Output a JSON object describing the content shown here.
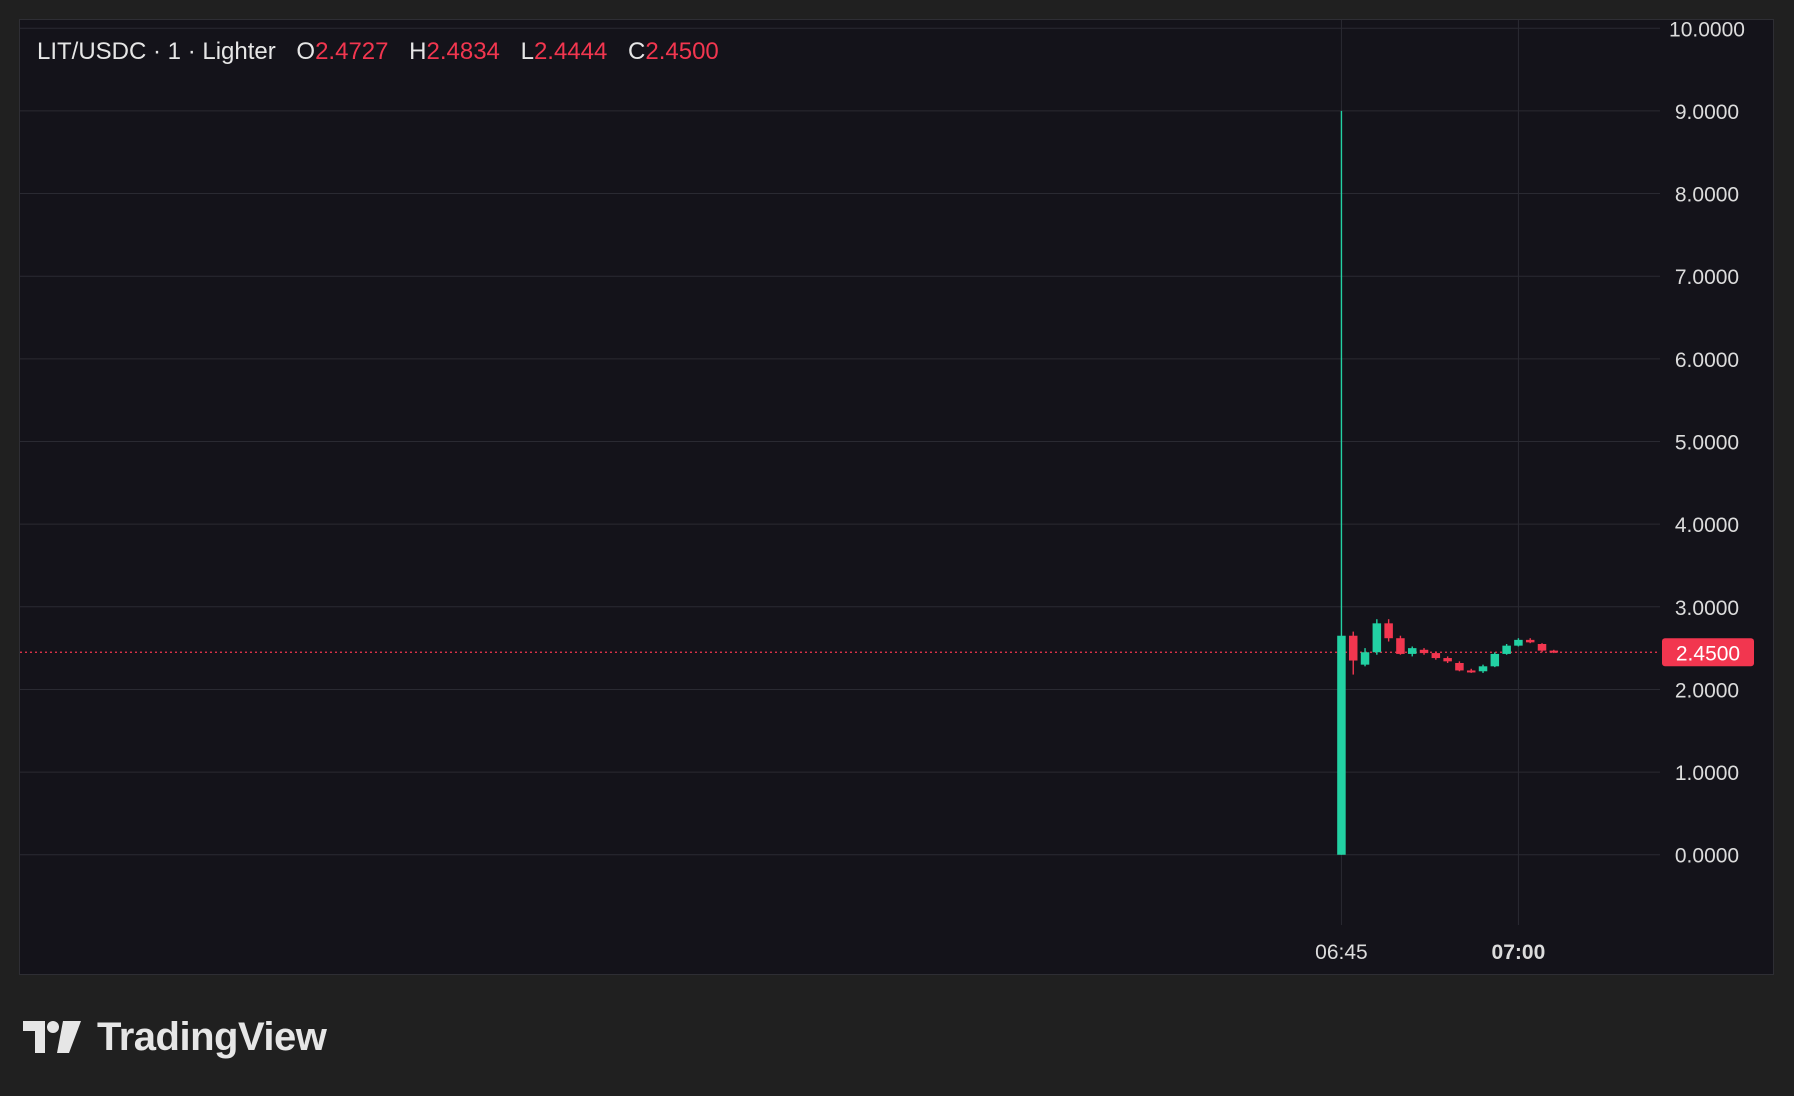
{
  "legend": {
    "symbol_text": "LIT/USDC · 1 · Lighter",
    "open_label": "O",
    "open_value": "2.4727",
    "high_label": "H",
    "high_value": "2.4834",
    "low_label": "L",
    "low_value": "2.4444",
    "close_label": "C",
    "close_value": "2.4500"
  },
  "footer": {
    "brand": "TradingView"
  },
  "colors": {
    "background": "#14131a",
    "grid": "#2a2a32",
    "up": "#22d1a3",
    "down": "#f2364f",
    "axis_text": "#dcdcdc",
    "price_line": "#f2364f"
  },
  "chart_data": {
    "type": "candlestick",
    "interval": "1",
    "ylim": [
      -0.85,
      10.1
    ],
    "y_ticks": [
      "10.0000",
      "9.0000",
      "8.0000",
      "7.0000",
      "6.0000",
      "5.0000",
      "4.0000",
      "3.0000",
      "2.0000",
      "1.0000",
      "0.0000"
    ],
    "y_tick_values": [
      10,
      9,
      8,
      7,
      6,
      5,
      4,
      3,
      2,
      1,
      0
    ],
    "x_ticks": [
      {
        "label": "06:45",
        "minute": 0,
        "bold": false
      },
      {
        "label": "07:00",
        "minute": 15,
        "bold": true
      }
    ],
    "x_minutes_range": [
      -112,
      27
    ],
    "last_price": 2.45,
    "last_price_label": "2.4500",
    "candles": [
      {
        "t": 0,
        "o": 0.0,
        "h": 9.0,
        "l": 0.0,
        "c": 2.65
      },
      {
        "t": 1,
        "o": 2.65,
        "h": 2.7,
        "l": 2.18,
        "c": 2.35
      },
      {
        "t": 2,
        "o": 2.3,
        "h": 2.5,
        "l": 2.28,
        "c": 2.45
      },
      {
        "t": 3,
        "o": 2.45,
        "h": 2.85,
        "l": 2.42,
        "c": 2.8
      },
      {
        "t": 4,
        "o": 2.8,
        "h": 2.85,
        "l": 2.58,
        "c": 2.62
      },
      {
        "t": 5,
        "o": 2.62,
        "h": 2.65,
        "l": 2.42,
        "c": 2.43
      },
      {
        "t": 6,
        "o": 2.43,
        "h": 2.52,
        "l": 2.4,
        "c": 2.5
      },
      {
        "t": 7,
        "o": 2.48,
        "h": 2.5,
        "l": 2.42,
        "c": 2.44
      },
      {
        "t": 8,
        "o": 2.44,
        "h": 2.46,
        "l": 2.36,
        "c": 2.38
      },
      {
        "t": 9,
        "o": 2.38,
        "h": 2.4,
        "l": 2.32,
        "c": 2.34
      },
      {
        "t": 10,
        "o": 2.32,
        "h": 2.34,
        "l": 2.22,
        "c": 2.23
      },
      {
        "t": 11,
        "o": 2.23,
        "h": 2.25,
        "l": 2.2,
        "c": 2.21
      },
      {
        "t": 12,
        "o": 2.22,
        "h": 2.3,
        "l": 2.2,
        "c": 2.28
      },
      {
        "t": 13,
        "o": 2.28,
        "h": 2.45,
        "l": 2.27,
        "c": 2.43
      },
      {
        "t": 14,
        "o": 2.43,
        "h": 2.55,
        "l": 2.42,
        "c": 2.53
      },
      {
        "t": 15,
        "o": 2.53,
        "h": 2.62,
        "l": 2.52,
        "c": 2.6
      },
      {
        "t": 16,
        "o": 2.6,
        "h": 2.62,
        "l": 2.56,
        "c": 2.57
      },
      {
        "t": 17,
        "o": 2.55,
        "h": 2.56,
        "l": 2.45,
        "c": 2.47
      },
      {
        "t": 18,
        "o": 2.47,
        "h": 2.48,
        "l": 2.44,
        "c": 2.45
      }
    ]
  }
}
